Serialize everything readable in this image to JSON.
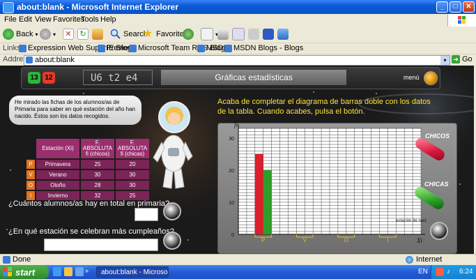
{
  "window": {
    "title": "about:blank - Microsoft Internet Explorer",
    "min": "_",
    "max": "□",
    "close": "✕"
  },
  "menu": {
    "items": [
      "File",
      "Edit",
      "View",
      "Favorites",
      "Tools",
      "Help"
    ]
  },
  "toolbar": {
    "back": "Back",
    "search": "Search",
    "favorites": "Favorites"
  },
  "links": {
    "label": "Links",
    "items": [
      "Expression Web SuperPreview",
      "IE Blog",
      "Microsoft Team RSS Blog",
      "MSDN",
      "MSDN Blogs - Blogs"
    ]
  },
  "address": {
    "label": "Address",
    "url": "about:blank",
    "go": "Go"
  },
  "app": {
    "badge_green": "13",
    "badge_red": "12",
    "unit_code": "U6 t2 e4",
    "topic": "Gráficas estadísticas",
    "menu_label": "menú",
    "bubble_text": "He mirado las fichas de los alumnos/as de Primaria para saber en qué estación del año han nacido. Éstos son los datos recogidos.",
    "table": {
      "headers": [
        "Estación (Xi)",
        "F. ABSOLUTA fi (chicos)",
        "F. ABSOLUTA fi (chicas)"
      ],
      "rows": [
        {
          "letter": "P",
          "season": "Primavera",
          "boys": "25",
          "girls": "20"
        },
        {
          "letter": "V",
          "season": "Verano",
          "boys": "30",
          "girls": "30"
        },
        {
          "letter": "O",
          "season": "Otoño",
          "boys": "28",
          "girls": "30"
        },
        {
          "letter": "I",
          "season": "Invierno",
          "boys": "32",
          "girls": "25"
        }
      ]
    },
    "question1": "¿Cuántos alumnos/as hay en total en primaria?",
    "question2": "¿En qué estación se celebran más cumpleaños?",
    "instructions": "Acaba de completar el diagrama de barras doble con los datos de la tabla. Cuando acabes, pulsa el botón.",
    "legend_boys": "CHICOS",
    "legend_girls": "CHICAS",
    "x_axis_caption": "estación de nacimiento",
    "y_axis_label": "fi",
    "x_axis_label": "Xi",
    "colors": {
      "boys": "#dd1f2b",
      "girls": "#2e9e2a"
    }
  },
  "chart_data": {
    "type": "bar",
    "categories": [
      "P",
      "V",
      "O",
      "I"
    ],
    "series": [
      {
        "name": "CHICOS",
        "values": [
          25,
          null,
          null,
          null
        ]
      },
      {
        "name": "CHICAS",
        "values": [
          20,
          null,
          null,
          null
        ]
      }
    ],
    "y_ticks": [
      "0",
      "10",
      "20",
      "30"
    ],
    "ylim": [
      0,
      33
    ],
    "grid": true
  },
  "status": {
    "text": "Done",
    "zone": "Internet"
  },
  "taskbar": {
    "start": "start",
    "task": "about:blank - Microso...",
    "lang": "EN",
    "time": "6:24"
  }
}
